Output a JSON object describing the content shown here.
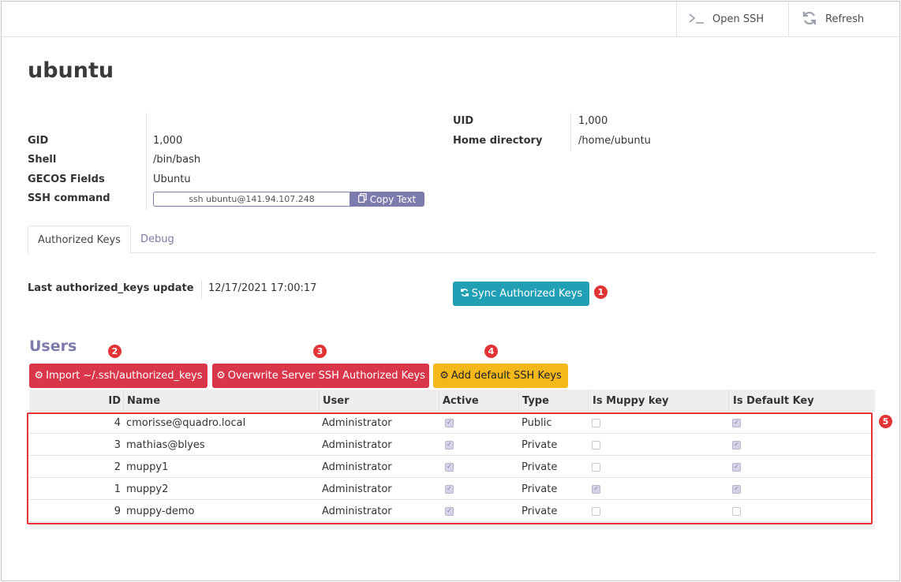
{
  "topbar": {
    "open_ssh": {
      "label": "Open SSH",
      "icon": "terminal-icon"
    },
    "refresh": {
      "label": "Refresh",
      "icon": "refresh-icon"
    }
  },
  "record": {
    "title": "ubuntu",
    "fields_left": [
      {
        "label": "GID",
        "value": "1,000"
      },
      {
        "label": "Shell",
        "value": "/bin/bash"
      },
      {
        "label": "GECOS Fields",
        "value": "Ubuntu"
      },
      {
        "label": "SSH command",
        "value": "ssh ubuntu@141.94.107.248"
      }
    ],
    "fields_right": [
      {
        "label": "UID",
        "value": "1,000"
      },
      {
        "label": "Home directory",
        "value": "/home/ubuntu"
      }
    ],
    "copy_button": "Copy Text"
  },
  "tabs": [
    {
      "label": "Authorized Keys",
      "active": true
    },
    {
      "label": "Debug",
      "active": false
    }
  ],
  "authorized_keys": {
    "last_update_label": "Last authorized_keys update",
    "last_update_value": "12/17/2021 17:00:17",
    "sync_button": "Sync Authorized Keys"
  },
  "users": {
    "heading": "Users",
    "buttons": {
      "import": "Import ~/.ssh/authorized_keys",
      "overwrite": "Overwrite Server SSH Authorized Keys",
      "add_default": "Add default SSH Keys"
    },
    "columns": [
      "ID",
      "Name",
      "User",
      "Active",
      "Type",
      "Is Muppy key",
      "Is Default Key"
    ],
    "rows": [
      {
        "id": "4",
        "name": "cmorisse@quadro.local",
        "user": "Administrator",
        "active": true,
        "type": "Public",
        "is_muppy": false,
        "is_default": true
      },
      {
        "id": "3",
        "name": "mathias@blyes",
        "user": "Administrator",
        "active": true,
        "type": "Private",
        "is_muppy": false,
        "is_default": true
      },
      {
        "id": "2",
        "name": "muppy1",
        "user": "Administrator",
        "active": true,
        "type": "Private",
        "is_muppy": false,
        "is_default": true
      },
      {
        "id": "1",
        "name": "muppy2",
        "user": "Administrator",
        "active": true,
        "type": "Private",
        "is_muppy": true,
        "is_default": true
      },
      {
        "id": "9",
        "name": "muppy-demo",
        "user": "Administrator",
        "active": true,
        "type": "Private",
        "is_muppy": false,
        "is_default": false
      }
    ]
  },
  "badges": [
    "1",
    "2",
    "3",
    "4",
    "5"
  ],
  "colors": {
    "accent": "#7c7bad",
    "sync": "#21a0b5",
    "danger": "#d9364a",
    "warning": "#f5b81a",
    "annotation": "#e23434"
  }
}
